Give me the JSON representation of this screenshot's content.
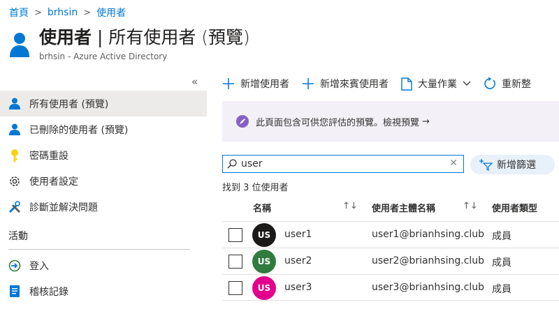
{
  "breadcrumb": {
    "items": [
      "首頁",
      "brhsin",
      "使用者"
    ],
    "sep": ">"
  },
  "header": {
    "title_bold": "使用者",
    "title_sep": " | ",
    "title_light": "所有使用者 (預覽)",
    "subtitle": "brhsin - Azure Active Directory"
  },
  "sidebar": {
    "collapse": "«",
    "items": [
      {
        "label": "所有使用者 (預覽)",
        "icon": "user-icon"
      },
      {
        "label": "已刪除的使用者 (預覽)",
        "icon": "user-icon"
      },
      {
        "label": "密碼重設",
        "icon": "key-icon"
      },
      {
        "label": "使用者設定",
        "icon": "gear-icon"
      },
      {
        "label": "診斷並解決問題",
        "icon": "wrench-icon"
      }
    ],
    "section_activity": "活動",
    "activity_items": [
      {
        "label": "登入",
        "icon": "sign-in-icon"
      },
      {
        "label": "稽核記錄",
        "icon": "audit-log-icon"
      }
    ]
  },
  "toolbar": {
    "new_user": "新增使用者",
    "new_guest": "新增來賓使用者",
    "bulk": "大量作業",
    "refresh": "重新整"
  },
  "banner": {
    "text": "此頁面包含可供您評估的預覽。檢視預覽",
    "arrow": "→"
  },
  "search": {
    "value": "user",
    "placeholder": ""
  },
  "filter": {
    "label": "新增篩選"
  },
  "result_count": "找到 3 位使用者",
  "table": {
    "columns": [
      "名稱",
      "使用者主體名稱",
      "使用者類型"
    ],
    "sort_glyph": "↑↓",
    "rows": [
      {
        "initials": "US",
        "name": "user1",
        "upn": "user1@brianhsing.club",
        "type": "成員",
        "color": "#1b1a19"
      },
      {
        "initials": "US",
        "name": "user2",
        "upn": "user2@brianhsing.club",
        "type": "成員",
        "color": "#2f7c3e"
      },
      {
        "initials": "US",
        "name": "user3",
        "upn": "user3@brianhsing.club",
        "type": "成員",
        "color": "#e3008c"
      }
    ]
  },
  "colors": {
    "accent": "#0078d4",
    "active_bg": "#edebe9",
    "banner_bg": "#f3f0f7",
    "preview_purple": "#8661c5"
  }
}
